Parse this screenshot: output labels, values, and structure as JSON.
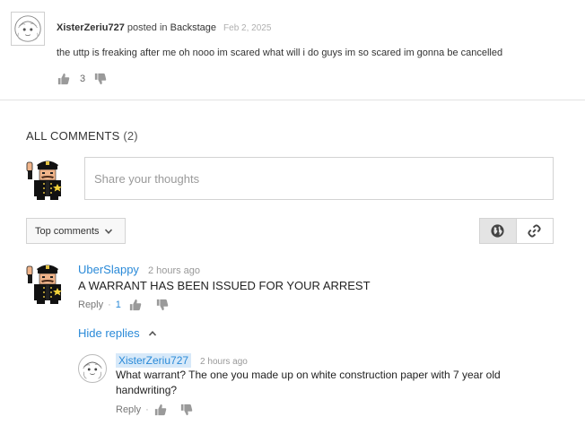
{
  "post": {
    "author": "XisterZeriu727",
    "posted_in_text": "posted in",
    "channel": "Backstage",
    "date": "Feb 2, 2025",
    "text": "the uttp is freaking after me oh nooo im scared what will i do guys im so scared im gonna be cancelled",
    "like_count": "3"
  },
  "comments_section": {
    "header_label": "ALL COMMENTS",
    "count": "(2)",
    "input_placeholder": "Share your thoughts",
    "sort_label": "Top comments",
    "view_options": [
      "globe-icon",
      "link-icon"
    ]
  },
  "comment": {
    "author": "UberSlappy",
    "time": "2 hours ago",
    "text": "A WARRANT HAS BEEN ISSUED FOR YOUR ARREST",
    "reply_label": "Reply",
    "like_count": "1",
    "hide_replies_label": "Hide replies"
  },
  "reply": {
    "author": "XisterZeriu727",
    "time": "2 hours ago",
    "text": "What warrant? The one you made up on white construction paper with 7 year old handwriting?",
    "reply_label": "Reply"
  },
  "colors": {
    "link_blue": "#2a8ad8",
    "author_highlight": "#d7e9f9",
    "muted": "#999999"
  }
}
